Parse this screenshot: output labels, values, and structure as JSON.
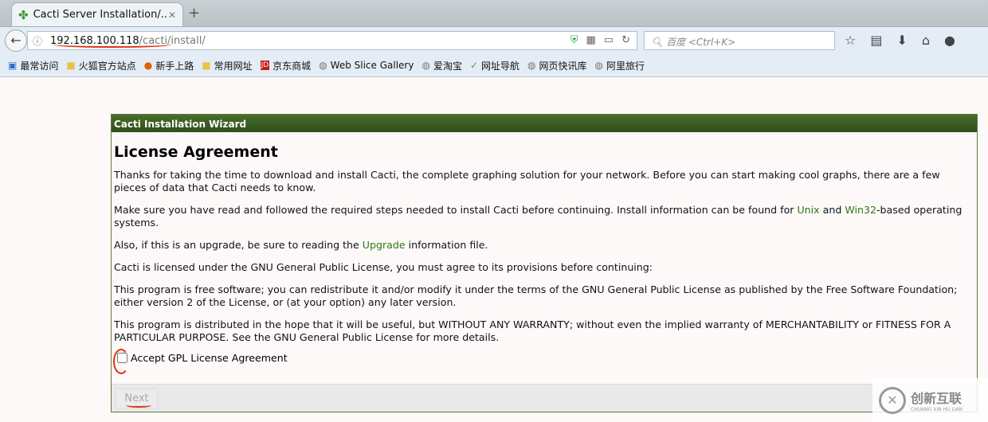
{
  "browser": {
    "tab_title": "Cacti Server Installation/...",
    "url_host": "192.168.100.118",
    "url_path": "/cacti/install/",
    "search_placeholder": "百度 <Ctrl+K>",
    "bookmarks": [
      "最常访问",
      "火狐官方站点",
      "新手上路",
      "常用网址",
      "京东商城",
      "Web Slice Gallery",
      "爱淘宝",
      "网址导航",
      "网页快讯库",
      "阿里旅行"
    ]
  },
  "wizard": {
    "header": "Cacti Installation Wizard",
    "title": "License Agreement",
    "p1": "Thanks for taking the time to download and install Cacti, the complete graphing solution for your network. Before you can start making cool graphs, there are a few pieces of data that Cacti needs to know.",
    "p2_a": "Make sure you have read and followed the required steps needed to install Cacti before continuing. Install information can be found for ",
    "p2_unix": "Unix",
    "p2_b": " and ",
    "p2_win": "Win32",
    "p2_c": "-based operating systems.",
    "p3_a": "Also, if this is an upgrade, be sure to reading the ",
    "p3_link": "Upgrade",
    "p3_b": " information file.",
    "p4": "Cacti is licensed under the GNU General Public License, you must agree to its provisions before continuing:",
    "p5": "This program is free software; you can redistribute it and/or modify it under the terms of the GNU General Public License as published by the Free Software Foundation; either version 2 of the License, or (at your option) any later version.",
    "p6": "This program is distributed in the hope that it will be useful, but WITHOUT ANY WARRANTY; without even the implied warranty of MERCHANTABILITY or FITNESS FOR A PARTICULAR PURPOSE. See the GNU General Public License for more details.",
    "accept_label": "Accept GPL License Agreement",
    "accept_checked": false,
    "next_label": "Next"
  },
  "watermark": {
    "name": "创新互联",
    "sub": "CHUANG XIN HU LIAN"
  },
  "colors": {
    "header": "#3b5e22",
    "link": "#2d7a12",
    "annotation": "#d31111"
  }
}
